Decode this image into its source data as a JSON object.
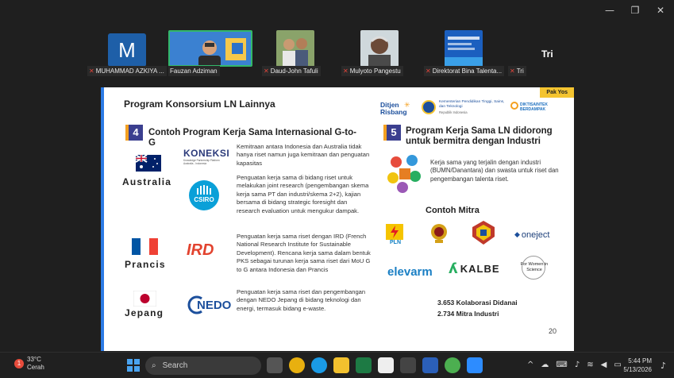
{
  "window_controls": {
    "minimize": "—",
    "restore": "❐",
    "close": "✕"
  },
  "participants": [
    {
      "initial": "M",
      "name": "MUHAMMAD AZKIYA ..."
    },
    {
      "name": "Fauzan Adziman"
    },
    {
      "name": "Daud-John Tafuli"
    },
    {
      "name": "Mulyoto Pangestu"
    },
    {
      "name": "Direktorat Bina Talenta..."
    },
    {
      "name": "Tri"
    }
  ],
  "tri_label": "Tri",
  "slide": {
    "speaker_tag": "Pak Yos",
    "title": "Program Konsorsium LN Lainnya",
    "header_logos": {
      "ditjen": "Ditjen Risbang",
      "kementerian": "Kementerian Pendidikan Tinggi, Sains, dan Teknologi",
      "kementerian_sub": "Republik Indonesia",
      "diktisaintek": "DIKTISAINTEK BERDAMPAK"
    },
    "section4": {
      "num": "4",
      "title": "Contoh Program Kerja Sama Internasional  G-to-G"
    },
    "section5": {
      "num": "5",
      "title": "Program Kerja Sama LN didorong untuk bermitra dengan Industri"
    },
    "countries": [
      "Australia",
      "Prancis",
      "Jepang"
    ],
    "logos": {
      "koneksi": "KONEKSI",
      "koneksi_sub": "Knowledge Partnership Platform Australia - Indonesia",
      "csiro": "CSIRO",
      "ird": "IRD",
      "nedo": "NEDO"
    },
    "paragraphs": [
      "Kemitraan antara Indonesia dan Australia tidak hanya riset namun juga kemitraan dan penguatan kapasitas",
      "Penguatan kerja sama di bidang riset untuk melakukan joint research (pengembangan skema kerja sama PT dan industri/skema 2+2), kajian bersama di bidang strategic foresight dan research evaluation untuk mengukur dampak.",
      "Penguatan kerja sama riset dengan IRD (French National Research Institute for Sustainable Development). Rencana kerja sama dalam bentuk PKS sebagai turunan kerja sama riset dari MoU G to G antara Indonesia dan Prancis",
      "Penguatan kerja sama riset dan pengembangan dengan NEDO Jepang di bidang teknologi dan energi, termasuk bidang e-waste."
    ],
    "industry_text": "Kerja sama yang terjalin dengan industri (BUMN/Danantara) dan swasta untuk riset dan pengembangan talenta riset.",
    "mitra_title": "Contoh Mitra",
    "mitra": {
      "pln": "PLN",
      "oneject": "oneject",
      "elevarm": "elevarm",
      "kalbe": "KALBE",
      "women": "For Women in Science"
    },
    "stats": [
      "3.653 Kolaborasi Didanai",
      "2.734 Mitra Industri"
    ],
    "page_number": "20"
  },
  "taskbar": {
    "weather_badge": "1",
    "temp": "33°C",
    "condition": "Cerah",
    "search_placeholder": "Search",
    "time": "5:44 PM",
    "date": "5/13/2026"
  },
  "colors": {
    "accent": "#2c7be5",
    "number_box": "#3b3f8f",
    "tag": "#f4c430"
  }
}
